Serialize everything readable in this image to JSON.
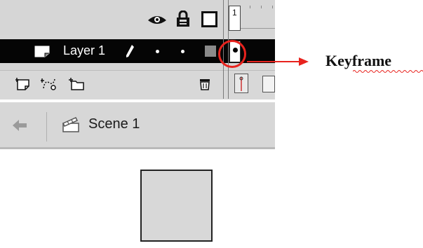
{
  "timeline": {
    "frame_number": "1",
    "layer": {
      "name": "Layer 1"
    }
  },
  "annotation": {
    "label": "Keyframe",
    "accent_color": "#e8231e"
  },
  "scene": {
    "label": "Scene 1"
  },
  "icons": {
    "header": [
      "eye-icon",
      "lock-icon",
      "outline-icon"
    ],
    "layer": [
      "layer-icon",
      "pencil-icon"
    ],
    "footer": [
      "insert-layer-icon",
      "add-motion-guide-icon",
      "insert-layer-folder-icon",
      "delete-layer-icon"
    ],
    "scene_bar": [
      "back-arrow-icon",
      "clapper-icon"
    ]
  }
}
